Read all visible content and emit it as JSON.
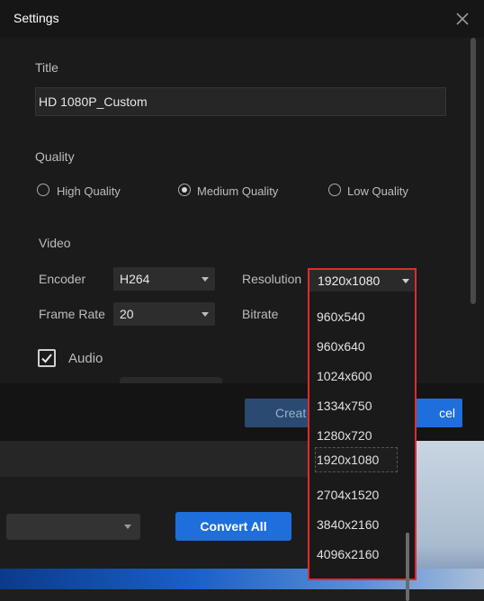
{
  "dialog": {
    "title": "Settings",
    "title_label": "Title",
    "title_value": "HD 1080P_Custom",
    "quality_label": "Quality",
    "quality_options": [
      {
        "label": "High Quality",
        "selected": false
      },
      {
        "label": "Medium Quality",
        "selected": true
      },
      {
        "label": "Low Quality",
        "selected": false
      }
    ],
    "video_label": "Video",
    "encoder_label": "Encoder",
    "encoder_value": "H264",
    "resolution_label": "Resolution",
    "resolution_value": "1920x1080",
    "frame_rate_label": "Frame Rate",
    "frame_rate_value": "20",
    "bitrate_label": "Bitrate",
    "audio_label": "Audio",
    "audio_checked": true,
    "create_label": "Creat",
    "cancel_label": "cel"
  },
  "resolution_options": [
    "960x540",
    "960x640",
    "1024x600",
    "1334x750",
    "1280x720",
    "1920x1080",
    "2704x1520",
    "3840x2160",
    "4096x2160"
  ],
  "resolution_selected": "1920x1080",
  "background": {
    "convert_all_label": "Convert All"
  },
  "colors": {
    "accent_blue": "#1e6fdc",
    "highlight_red": "#e42a2a"
  }
}
